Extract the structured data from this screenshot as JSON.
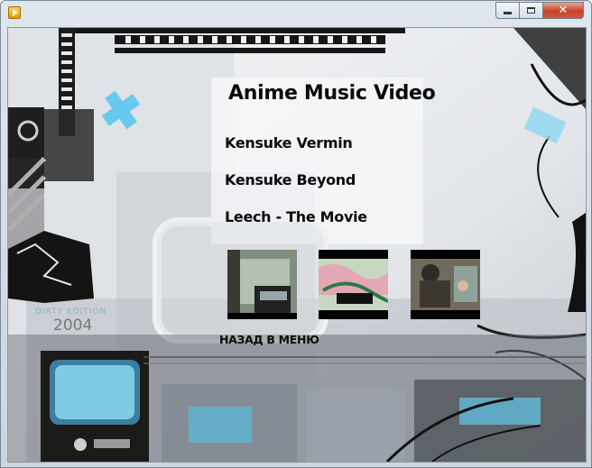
{
  "window": {
    "title": "",
    "controls": {
      "minimize": "minimize",
      "maximize": "maximize",
      "close": "✕"
    }
  },
  "menu": {
    "title": "Anime Music Video",
    "items": [
      {
        "label": "Kensuke  Vermin"
      },
      {
        "label": "Kensuke  Beyond"
      },
      {
        "label": "Leech - The Movie"
      }
    ],
    "back_label": "НАЗАД В МЕНЮ"
  },
  "background": {
    "edition_text": "DIRTY EDITION",
    "year_text": "2004"
  },
  "thumbnails": [
    {
      "name": "thumbnail-1"
    },
    {
      "name": "thumbnail-2"
    },
    {
      "name": "thumbnail-3"
    }
  ],
  "colors": {
    "accent_cyan": "#4fc3e8",
    "text": "#0a0a0a"
  }
}
